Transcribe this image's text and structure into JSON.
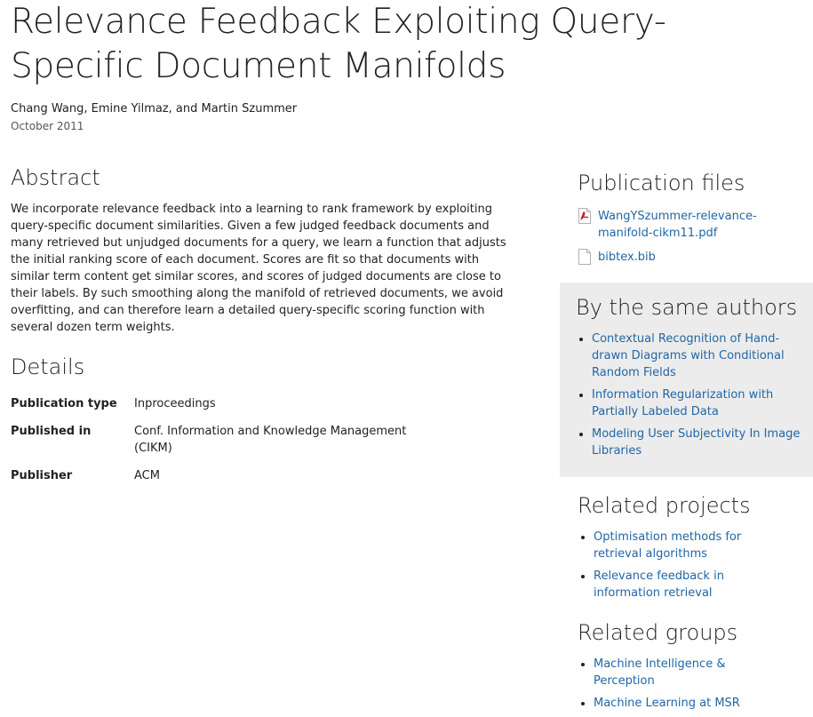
{
  "title": "Relevance Feedback Exploiting Query-Specific Document Manifolds",
  "authors": "Chang Wang, Emine Yilmaz, and Martin Szummer",
  "date": "October 2011",
  "abstract": {
    "heading": "Abstract",
    "text": "We incorporate relevance feedback into a learning to rank framework by exploiting query-specific document similarities. Given a few judged feedback documents and many retrieved but unjudged documents for a query, we learn a function that adjusts the initial ranking score of each document. Scores are fit so that documents with similar term content get similar scores, and scores of judged documents are close to their labels. By such smoothing along the manifold of retrieved documents, we avoid overfitting, and can therefore learn a detailed query-specific scoring function with several dozen term weights."
  },
  "details": {
    "heading": "Details",
    "rows": [
      {
        "label": "Publication type",
        "value": "Inproceedings"
      },
      {
        "label": "Published in",
        "value": "Conf. Information and Knowledge Management (CIKM)"
      },
      {
        "label": "Publisher",
        "value": "ACM"
      }
    ]
  },
  "publication_files": {
    "heading": "Publication files",
    "files": [
      {
        "label": "WangYSzummer-relevance-manifold-cikm11.pdf",
        "icon": "pdf-file-icon"
      },
      {
        "label": "bibtex.bib",
        "icon": "text-file-icon"
      }
    ]
  },
  "same_authors": {
    "heading": "By the same authors",
    "items": [
      "Contextual Recognition of Hand-drawn Diagrams with Conditional Random Fields",
      "Information Regularization with Partially Labeled Data",
      "Modeling User Subjectivity In Image Libraries"
    ]
  },
  "related_projects": {
    "heading": "Related projects",
    "items": [
      "Optimisation methods for retrieval algorithms",
      "Relevance feedback in information retrieval"
    ]
  },
  "related_groups": {
    "heading": "Related groups",
    "items": [
      "Machine Intelligence & Perception",
      "Machine Learning at MSR"
    ]
  },
  "colors": {
    "link": "#2166a5",
    "sidebar_background": "#ececec",
    "pdf_icon": "#c4161c"
  }
}
